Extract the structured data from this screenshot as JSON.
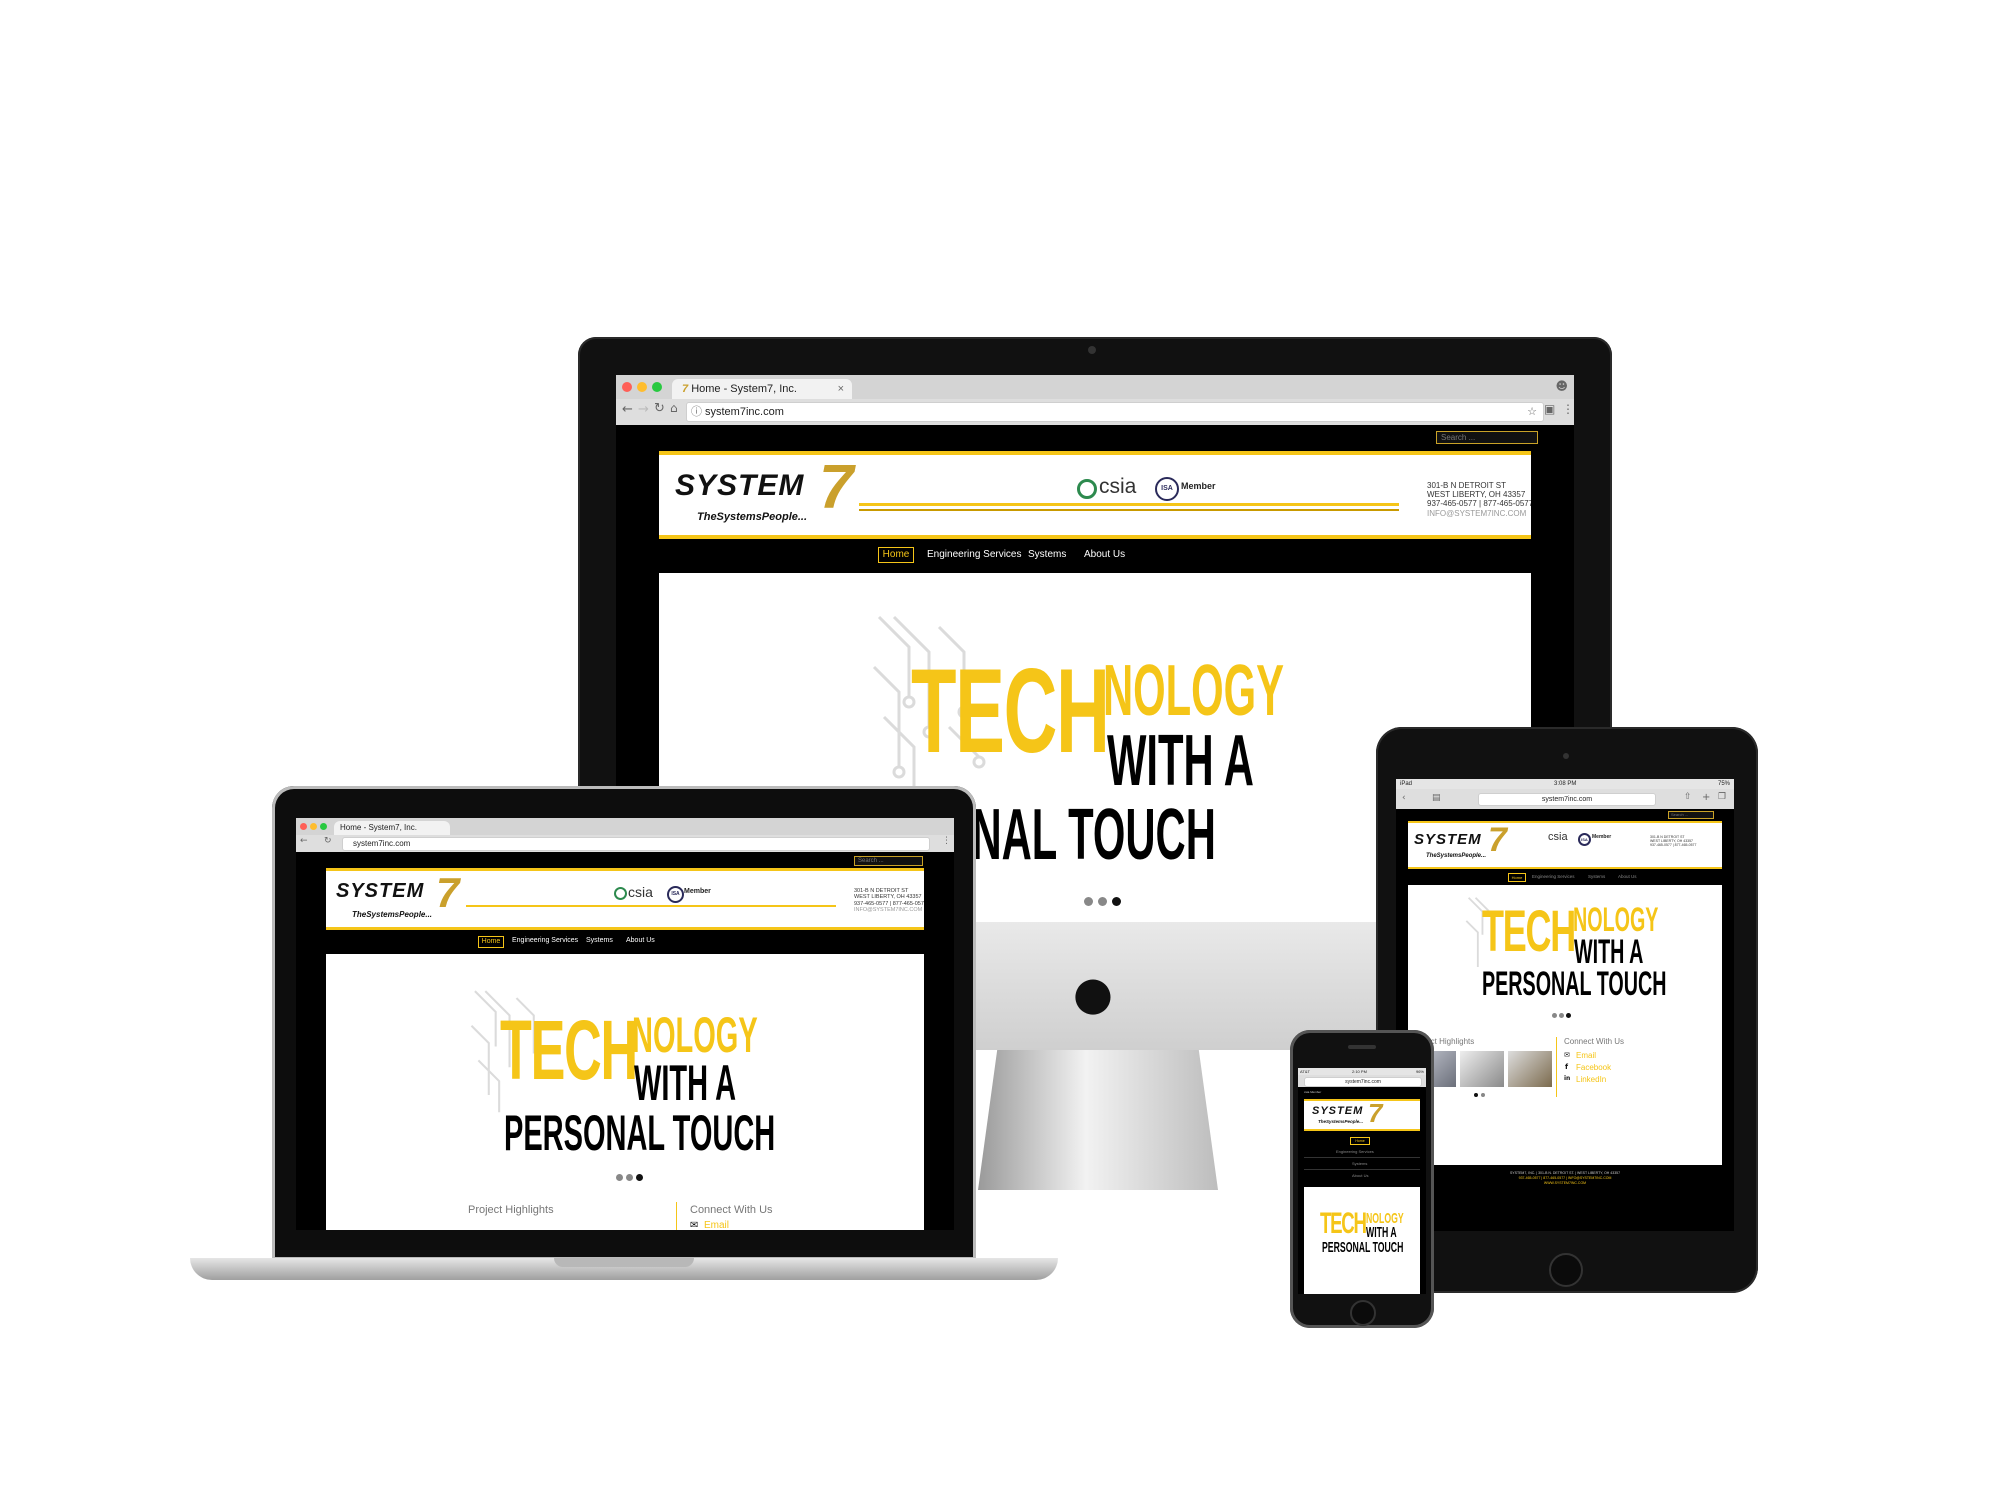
{
  "browser": {
    "tab_title": "Home - System7, Inc.",
    "url": "system7inc.com"
  },
  "site": {
    "search_placeholder": "Search ...",
    "logo_word": "SYSTEM",
    "logo_number": "7",
    "tagline": "TheSystemsPeople...",
    "csia_label": "csia",
    "isa_label": "ISA",
    "member_label": "Member",
    "address": {
      "line1": "301-B N DETROIT ST",
      "line2": "WEST LIBERTY, OH 43357",
      "line3": "937-465-0577 | 877-465-0577",
      "line4": "INFO@SYSTEM7INC.COM"
    },
    "nav": [
      "Home",
      "Engineering Services",
      "Systems",
      "About Us"
    ],
    "hero": {
      "tech": "TECH",
      "nology": "NOLOGY",
      "line2": "WITH A",
      "line3": "PERSONAL TOUCH",
      "line3_cropped": "RSONAL TOUCH"
    },
    "project_highlights": "Project Highlights",
    "connect": {
      "title": "Connect With Us",
      "links": [
        "Email",
        "Facebook",
        "LinkedIn"
      ]
    },
    "footer_line1": "SYSTEM7, INC. | 301-B N. DETROIT ST. | WEST LIBERTY, OH 43357",
    "footer_line2": "937-465-0577 | 877-465-0577 | INFO@SYSTEM7INC.COM",
    "footer_line3": "WWW.SYSTEM7INC.COM"
  },
  "ipad_status": {
    "carrier": "iPad",
    "time": "3:08 PM",
    "battery": "75%"
  },
  "iphone_status": {
    "carrier": "AT&T",
    "time": "2:10 PM",
    "battery": "96%"
  },
  "colors": {
    "accent": "#f5c518",
    "accent_dark": "#caa02c",
    "site_bg": "#000000",
    "csia_green": "#2d8a4e"
  }
}
